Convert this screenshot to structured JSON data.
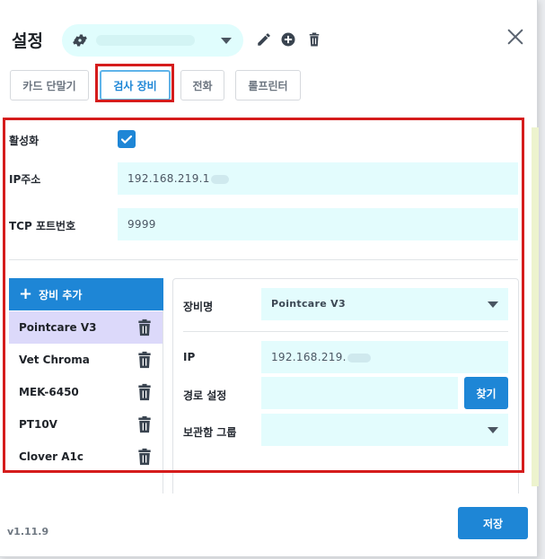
{
  "header": {
    "title": "설정",
    "profile_value": ""
  },
  "tabs": [
    {
      "label": "카드 단말기",
      "active": false
    },
    {
      "label": "검사 장비",
      "active": true
    },
    {
      "label": "전화",
      "active": false
    },
    {
      "label": "롤프린터",
      "active": false
    }
  ],
  "form": {
    "enabled_label": "활성화",
    "enabled": true,
    "ip_label": "IP주소",
    "ip_value": "192.168.219.1",
    "port_label": "TCP 포트번호",
    "port_value": "9999"
  },
  "devices": {
    "add_label": "장비 추가",
    "items": [
      {
        "name": "Pointcare V3",
        "selected": true
      },
      {
        "name": "Vet Chroma",
        "selected": false
      },
      {
        "name": "MEK-6450",
        "selected": false
      },
      {
        "name": "PT10V",
        "selected": false
      },
      {
        "name": "Clover A1c",
        "selected": false
      }
    ]
  },
  "detail": {
    "device_name_label": "장비명",
    "device_name_value": "Pointcare V3",
    "ip_label": "IP",
    "ip_value": "192.168.219.",
    "path_label": "경로 설정",
    "path_value": "",
    "find_label": "찾기",
    "locker_label": "보관함 그룹",
    "locker_value": ""
  },
  "footer": {
    "version": "v1.11.9",
    "save_label": "저장"
  },
  "colors": {
    "primary": "#1e86d6",
    "field_bg": "#e3fcfd",
    "selected_row": "#dcd9fa",
    "highlight": "#d51c1c"
  },
  "icons": [
    "gear-icon",
    "pencil-icon",
    "plus-circle-icon",
    "trash-icon",
    "close-icon",
    "check-icon",
    "chevron-down-icon"
  ]
}
